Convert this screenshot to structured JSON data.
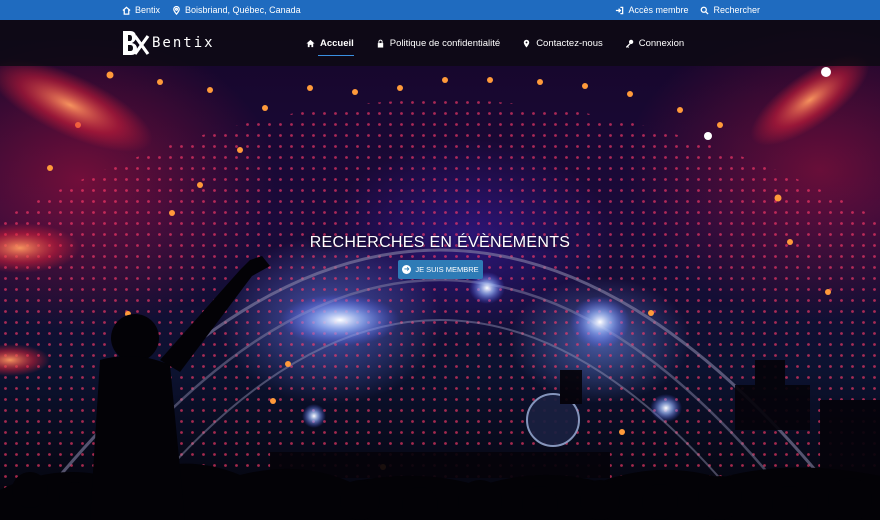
{
  "topbar": {
    "brand": "Bentix",
    "location": "Boisbriand, Québec, Canada",
    "member_access": "Accès membre",
    "search": "Rechercher"
  },
  "logo": {
    "text": "Bentix"
  },
  "nav": {
    "items": [
      {
        "label": "Accueil",
        "icon": "home-icon",
        "active": true
      },
      {
        "label": "Politique de confidentialité",
        "icon": "lock-icon",
        "active": false
      },
      {
        "label": "Contactez-nous",
        "icon": "map-pin-icon",
        "active": false
      },
      {
        "label": "Connexion",
        "icon": "key-icon",
        "active": false
      }
    ]
  },
  "hero": {
    "title": "RECHERCHES EN ÉVÈNEMENTS",
    "cta_label": "JE SUIS MEMBRE",
    "cta_icon": "arrow-circle-icon"
  },
  "colors": {
    "topbar": "#1f6bbf",
    "cta": "#2e7bb6",
    "nav_underline": "#3a8fe0"
  }
}
